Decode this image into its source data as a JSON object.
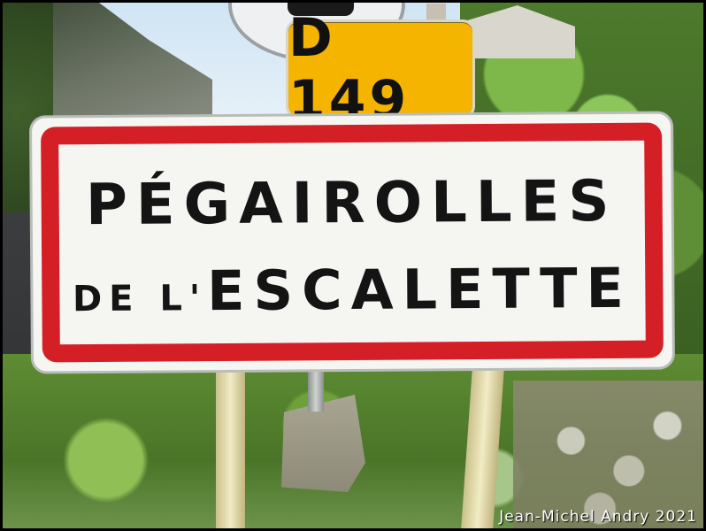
{
  "road_plate": {
    "text": "D 149",
    "color": "#f4b400"
  },
  "town_sign": {
    "line1": "PÉGAIROLLES",
    "line2_prefix": "DE L'",
    "line2_main": "ESCALETTE",
    "border_color": "#d41f26"
  },
  "watermark": {
    "text": "Jean-Michel Andry 2021"
  }
}
